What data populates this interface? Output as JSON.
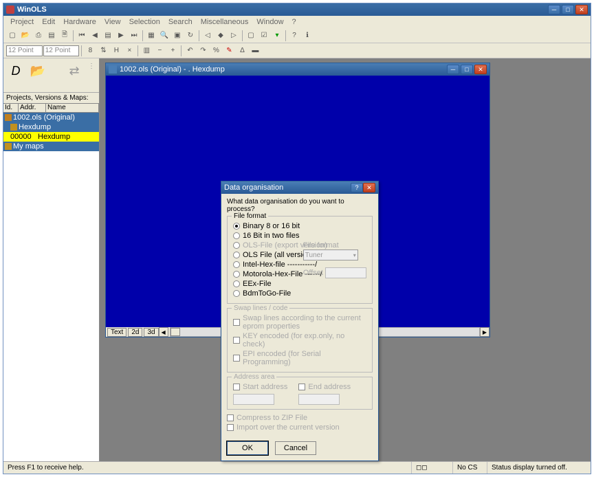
{
  "app": {
    "title": "WinOLS"
  },
  "menu": [
    "Project",
    "Edit",
    "Hardware",
    "View",
    "Selection",
    "Search",
    "Miscellaneous",
    "Window",
    "?"
  ],
  "combos": {
    "c1": "12 Point",
    "c2": "12 Point"
  },
  "side": {
    "header": "Projects, Versions & Maps:",
    "cols": [
      "Id.",
      "Addr.",
      "Name"
    ],
    "rows": [
      {
        "text": "1002.ols (Original)",
        "sel": true
      },
      {
        "text": "Hexdump",
        "indent": 1
      },
      {
        "addr": "00000",
        "name": "Hexdump",
        "hl": true,
        "indent": 1
      },
      {
        "text": "My maps",
        "indent": 0
      }
    ]
  },
  "mdi": {
    "title": "1002.ols (Original) - . Hexdump",
    "tabs": [
      "Text",
      "2d",
      "3d"
    ]
  },
  "dialog": {
    "title": "Data organisation",
    "question": "What data organisation do you want to process?",
    "fileformat": {
      "legend": "File format",
      "options": [
        {
          "label": "Binary 8 or 16 bit",
          "on": true
        },
        {
          "label": "16 Bit in two files"
        },
        {
          "label": "OLS-File (export version)",
          "disabled": true
        },
        {
          "label": "OLS File (all versions) ------/"
        },
        {
          "label": "Intel-Hex-file -----------/"
        },
        {
          "label": "Motorola-Hex-File ------/"
        },
        {
          "label": "EEx-File"
        },
        {
          "label": "BdmToGo-File"
        }
      ],
      "sideCombo": {
        "label": "File format",
        "value": "Tuner"
      },
      "sideOffset": "Offset"
    },
    "swap": {
      "legend": "Swap lines / code",
      "options": [
        {
          "label": "Swap lines according to the current eprom properties"
        },
        {
          "label": "KEY encoded (for exp.only, no check)"
        },
        {
          "label": "EPI encoded (for Serial Programming)"
        }
      ]
    },
    "address": {
      "legend": "Address area",
      "start": "Start address",
      "end": "End address"
    },
    "compress": "Compress to ZIP File",
    "importOver": "Import over the current version",
    "ok": "OK",
    "cancel": "Cancel"
  },
  "status": {
    "left": "Press F1 to receive help.",
    "cs": "No CS",
    "right": "Status display turned off."
  }
}
